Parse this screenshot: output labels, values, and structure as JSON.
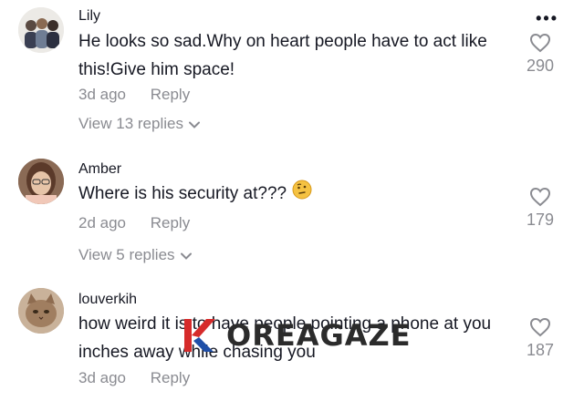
{
  "comments": [
    {
      "username": "Lily",
      "text": "He looks so sad.Why on heart people have to act like this!Give him space!",
      "time": "3d ago",
      "reply": "Reply",
      "view_replies": "View 13 replies",
      "likes": "290",
      "avatar_icon": "group-photo-avatar"
    },
    {
      "username": "Amber",
      "text": "Where is his security at???",
      "emoji": "thinking-face-icon",
      "time": "2d ago",
      "reply": "Reply",
      "view_replies": "View 5 replies",
      "likes": "179",
      "avatar_icon": "woman-photo-avatar"
    },
    {
      "username": "louverkih",
      "text": "how weird it is to have people pointing a phone at you inches away while chasing you",
      "time": "3d ago",
      "reply": "Reply",
      "likes": "187",
      "avatar_icon": "cat-photo-avatar"
    }
  ],
  "more_icon": "more-options-icon",
  "watermark": {
    "text": "OREAGAZE",
    "logo": "koreagaze-logo"
  }
}
